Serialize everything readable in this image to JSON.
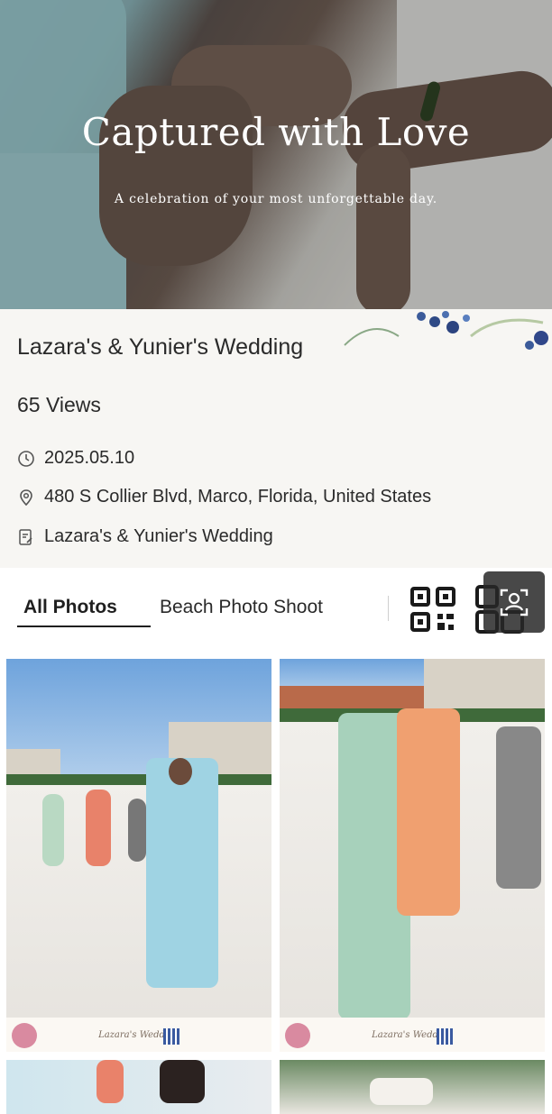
{
  "hero": {
    "title": "Captured with Love",
    "subtitle": "A celebration of your most unforgettable day."
  },
  "event": {
    "title": "Lazara's & Yunier's Wedding",
    "views": "65 Views",
    "date": "2025.05.10",
    "location": "480 S Collier Blvd, Marco, Florida, United States",
    "album": "Lazara's & Yunier's Wedding"
  },
  "tabs": [
    {
      "label": "All Photos",
      "active": true
    },
    {
      "label": "Beach Photo Shoot",
      "active": false
    }
  ],
  "icons": {
    "date": "clock-icon",
    "location": "location-pin-icon",
    "album": "document-edit-icon",
    "qr": "qr-code-icon",
    "face": "face-search-icon"
  },
  "photo_banner": {
    "text": "Lazara's Wedding"
  },
  "colors": {
    "tab_active": "#1f1f1f",
    "overlay": "#282828"
  }
}
